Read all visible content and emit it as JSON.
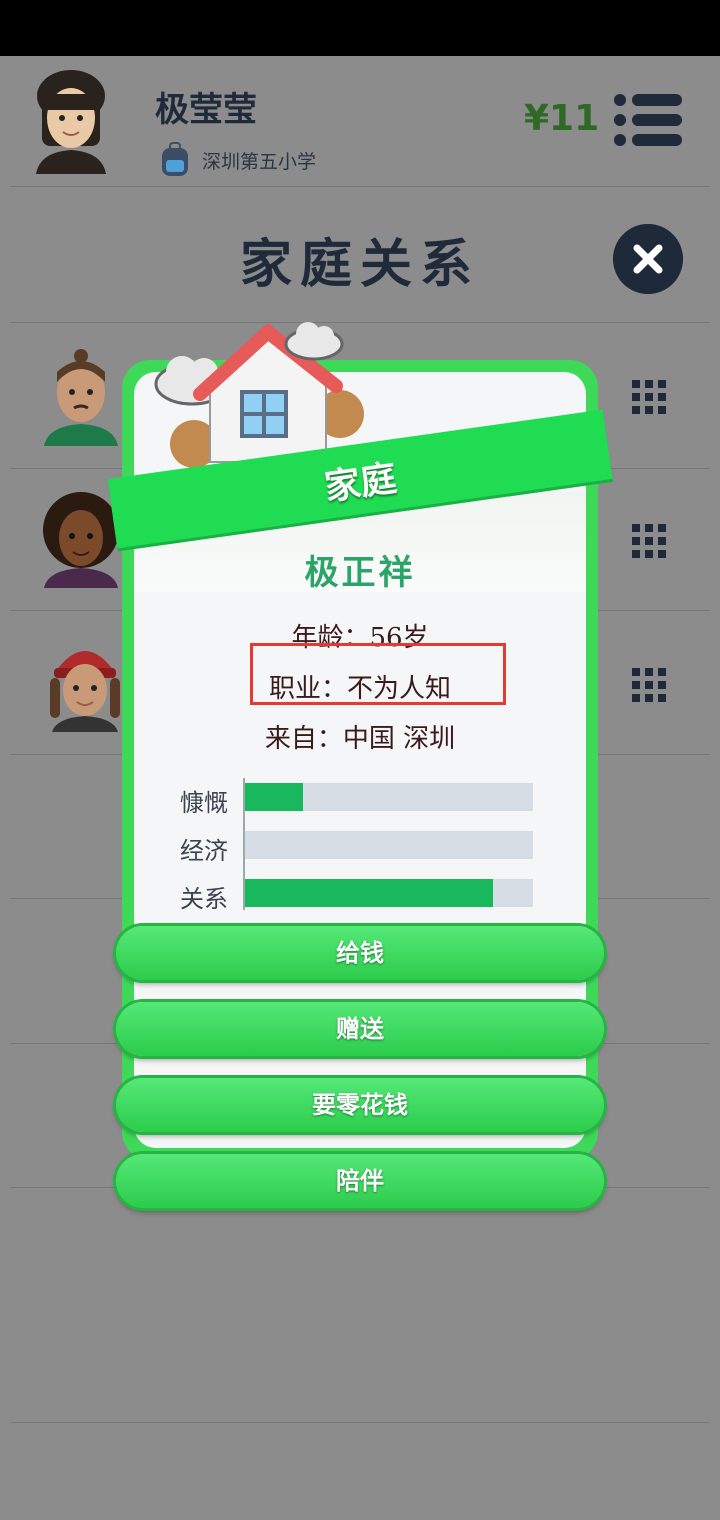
{
  "header": {
    "player_name": "极莹莹",
    "school": "深圳第五小学",
    "money": "¥11"
  },
  "page_title": "家庭关系",
  "modal": {
    "banner": "家庭",
    "name": "极正祥",
    "age_line": "年龄：56岁",
    "job_line": "职业：不为人知",
    "from_line": "来自：中国 深圳",
    "stats": [
      {
        "label": "慷慨",
        "value": 0.2
      },
      {
        "label": "经济",
        "value": 0.0
      },
      {
        "label": "关系",
        "value": 0.86
      }
    ],
    "buttons": [
      "给钱",
      "赠送",
      "要零花钱",
      "陪伴"
    ]
  },
  "colors": {
    "accent_green": "#1fdc52",
    "stat_fill": "#1ab85c",
    "money": "#2e6a26",
    "highlight": "#e53935"
  }
}
